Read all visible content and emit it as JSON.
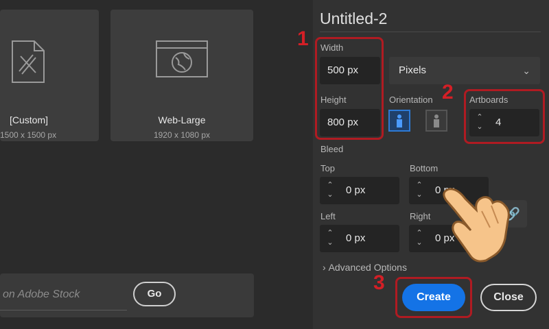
{
  "presets": [
    {
      "name": "[Custom]",
      "size": "1500 x 1500 px",
      "icon": "document-ruler-icon"
    },
    {
      "name": "Web-Large",
      "size": "1920 x 1080 px",
      "icon": "browser-globe-icon"
    }
  ],
  "stock": {
    "placeholder": "on Adobe Stock",
    "go_label": "Go"
  },
  "doc": {
    "title": "Untitled-2",
    "width_label": "Width",
    "width_value": "500 px",
    "height_label": "Height",
    "height_value": "800 px",
    "units": "Pixels",
    "orientation_label": "Orientation",
    "artboards_label": "Artboards",
    "artboards_value": "4",
    "bleed_label": "Bleed",
    "top_label": "Top",
    "top_value": "0 px",
    "bottom_label": "Bottom",
    "bottom_value": "0 px",
    "left_label": "Left",
    "left_value": "0 px",
    "right_label": "Right",
    "right_value": "0 px",
    "advanced_label": "Advanced Options"
  },
  "buttons": {
    "create": "Create",
    "close": "Close"
  },
  "callouts": [
    "1",
    "2",
    "3"
  ],
  "colors": {
    "accent": "#1473e6",
    "callout": "#d41f26",
    "panel": "#323232"
  }
}
